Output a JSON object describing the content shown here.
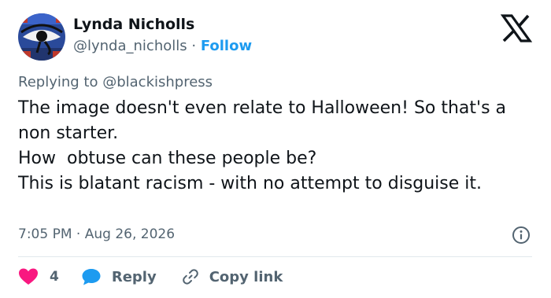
{
  "author": {
    "name": "Lynda Nicholls",
    "handle": "@lynda_nicholls",
    "separator": "·",
    "follow_label": "Follow",
    "avatar": "egyptian-eye-painting"
  },
  "platform_logo": "x-logo-icon",
  "reply_context": {
    "prefix": "Replying to",
    "mention": "@blackishpress"
  },
  "tweet_text": "The image doesn't even relate to Halloween! So that's a non starter.\nHow  obtuse can these people be?\nThis is blatant racism - with no attempt to disguise it.",
  "timestamp": {
    "time": "7:05 PM",
    "separator": "·",
    "date": "Aug 26, 2026"
  },
  "actions": {
    "like_count": "4",
    "reply_label": "Reply",
    "copy_link_label": "Copy link"
  },
  "colors": {
    "accent": "#1d9bf0",
    "like": "#f91880",
    "muted": "#536471",
    "text": "#0f1419"
  }
}
